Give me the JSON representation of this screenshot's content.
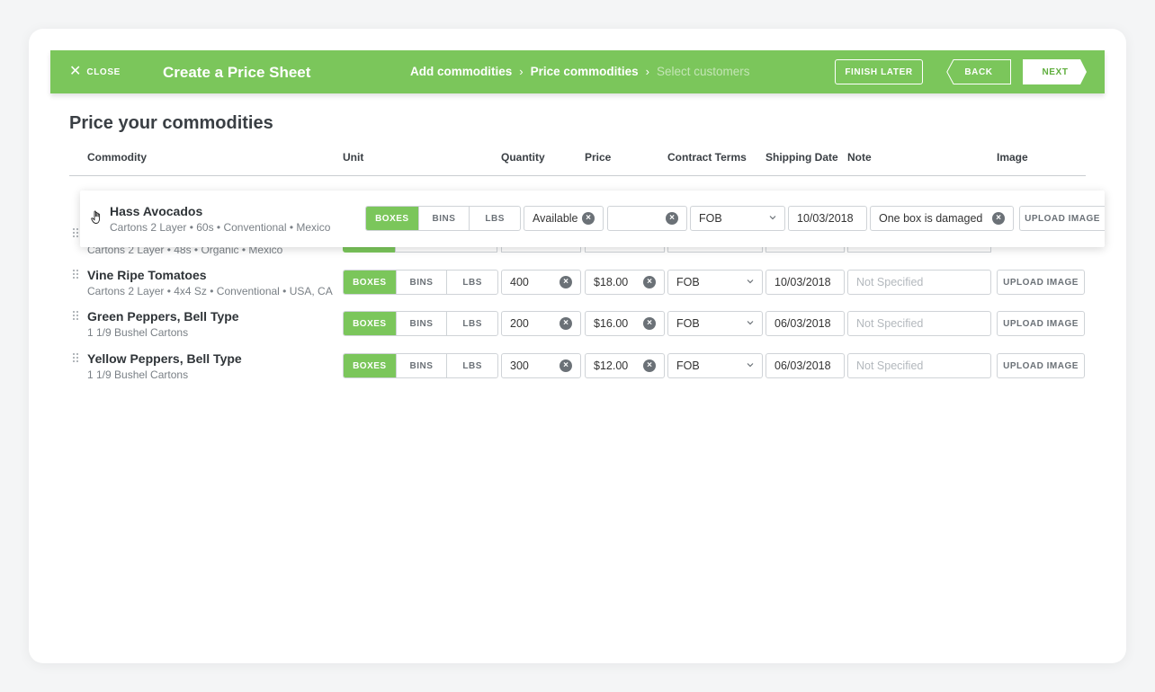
{
  "header": {
    "close_label": "CLOSE",
    "title": "Create a Price Sheet",
    "steps": [
      {
        "label": "Add commodities",
        "state": "done"
      },
      {
        "label": "Price commodities",
        "state": "current"
      },
      {
        "label": "Select customers",
        "state": "inactive"
      }
    ],
    "finish_later": "FINISH LATER",
    "back": "BACK",
    "next": "NEXT",
    "accent_color": "#7bc65b"
  },
  "page_title": "Price your commodities",
  "columns": [
    "Commodity",
    "Unit",
    "Quantity",
    "Price",
    "Contract Terms",
    "Shipping Date",
    "Note",
    "Image"
  ],
  "unit_options": [
    "BOXES",
    "BINS",
    "LBS"
  ],
  "upload_label": "UPLOAD IMAGE",
  "dragged_row": {
    "name": "Hass Avocados",
    "desc": "Cartons 2 Layer • 60s • Conventional • Mexico",
    "unit": "BOXES",
    "quantity": "Available",
    "price": "",
    "terms": "FOB",
    "date": "10/03/2018",
    "note": "One box is damaged"
  },
  "hidden_row_desc": "Cartons 2 Layer • 48s • Organic • Mexico",
  "rows": [
    {
      "name": "Vine Ripe Tomatoes",
      "desc": "Cartons 2 Layer • 4x4 Sz • Conventional • USA, CA",
      "unit": "BOXES",
      "quantity": "400",
      "price": "$18.00",
      "terms": "FOB",
      "date": "10/03/2018",
      "note_placeholder": "Not Specified"
    },
    {
      "name": "Green Peppers, Bell Type",
      "desc": "1 1/9 Bushel Cartons",
      "unit": "BOXES",
      "quantity": "200",
      "price": "$16.00",
      "terms": "FOB",
      "date": "06/03/2018",
      "note_placeholder": "Not Specified"
    },
    {
      "name": "Yellow Peppers, Bell Type",
      "desc": "1 1/9 Bushel Cartons",
      "unit": "BOXES",
      "quantity": "300",
      "price": "$12.00",
      "terms": "FOB",
      "date": "06/03/2018",
      "note_placeholder": "Not Specified"
    }
  ]
}
